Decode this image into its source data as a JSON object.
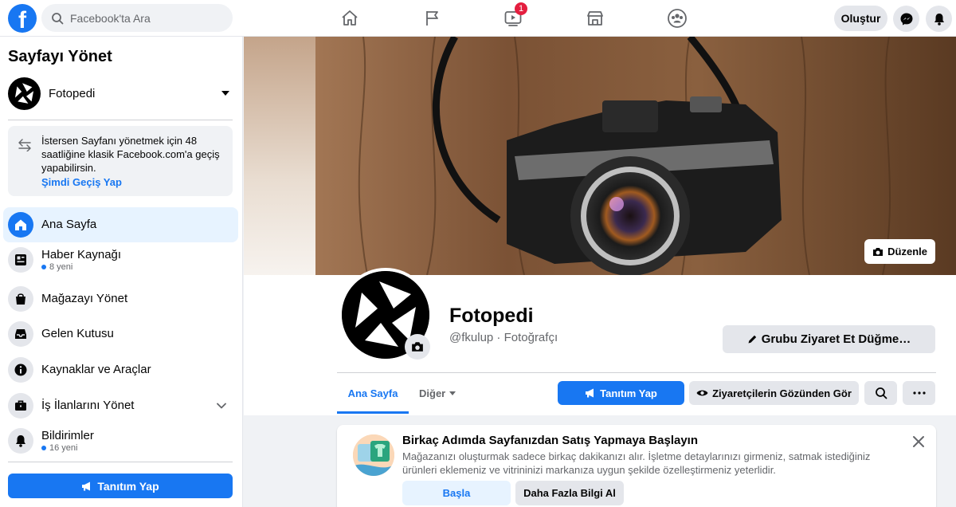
{
  "topbar": {
    "logo_letter": "f",
    "search_placeholder": "Facebook'ta Ara",
    "video_badge": "1",
    "create_label": "Oluştur",
    "nav_icons": [
      "home-icon",
      "flag-icon",
      "video-icon",
      "marketplace-icon",
      "groups-icon"
    ]
  },
  "sidebar": {
    "title": "Sayfayı Yönet",
    "page_name": "Fotopedi",
    "notice_text": "İstersen Sayfanı yönetmek için 48 saatliğine klasik Facebook.com'a geçiş yapabilirsin.",
    "notice_link": "Şimdi Geçiş Yap",
    "items": [
      {
        "label": "Ana Sayfa",
        "icon": "home-icon",
        "active": true
      },
      {
        "label": "Haber Kaynağı",
        "sub": "8 yeni",
        "icon": "news-feed-icon"
      },
      {
        "label": "Mağazayı Yönet",
        "icon": "shopping-bag-icon"
      },
      {
        "label": "Gelen Kutusu",
        "icon": "inbox-icon"
      },
      {
        "label": "Kaynaklar ve Araçlar",
        "icon": "info-icon"
      },
      {
        "label": "İş İlanlarını Yönet",
        "icon": "briefcase-icon"
      },
      {
        "label": "Bildirimler",
        "sub": "16 yeni",
        "icon": "bell-icon"
      }
    ],
    "promote_label": "Tanıtım Yap"
  },
  "page": {
    "cover_edit_label": "Düzenle",
    "name": "Fotopedi",
    "handle": "@fkulup · Fotoğrafçı",
    "visit_button": "Grubu Ziyaret Et Düğme…",
    "tabs": {
      "home": "Ana Sayfa",
      "more": "Diğer"
    },
    "promote_label": "Tanıtım Yap",
    "view_as_label": "Ziyaretçilerin Gözünden Gör"
  },
  "card": {
    "title": "Birkaç Adımda Sayfanızdan Satış Yapmaya Başlayın",
    "description": "Mağazanızı oluşturmak sadece birkaç dakikanızı alır. İşletme detaylarınızı girmeniz, satmak istediğiniz ürünleri eklemeniz ve vitrininizi markanıza uygun şekilde özelleştirmeniz yeterlidir.",
    "start_label": "Başla",
    "more_label": "Daha Fazla Bilgi Al"
  },
  "colors": {
    "accent": "#1877f2",
    "badge": "#e41e3f"
  }
}
